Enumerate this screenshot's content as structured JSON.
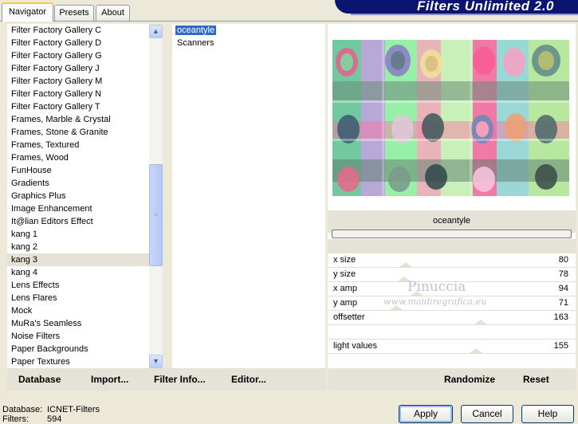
{
  "tabs": [
    {
      "label": "Navigator",
      "active": true
    },
    {
      "label": "Presets",
      "active": false
    },
    {
      "label": "About",
      "active": false
    }
  ],
  "banner": {
    "title": "Filters Unlimited 2.0"
  },
  "categories": [
    "Filter Factory Gallery C",
    "Filter Factory Gallery D",
    "Filter Factory Gallery G",
    "Filter Factory Gallery J",
    "Filter Factory Gallery M",
    "Filter Factory Gallery N",
    "Filter Factory Gallery T",
    "Frames, Marble & Crystal",
    "Frames, Stone & Granite",
    "Frames, Textured",
    "Frames, Wood",
    "FunHouse",
    "Gradients",
    "Graphics Plus",
    "Image Enhancement",
    "It@lian Editors Effect",
    "kang 1",
    "kang 2",
    "kang 3",
    "kang 4",
    "Lens Effects",
    "Lens Flares",
    "Mock",
    "MuRa's Seamless",
    "Noise Filters",
    "Paper Backgrounds",
    "Paper Textures"
  ],
  "selected_category": "kang 3",
  "effects": [
    "oceantyle",
    "Scanners"
  ],
  "selected_effect": "oceantyle",
  "preview": {
    "filter_name": "oceantyle",
    "progress": 0
  },
  "params": [
    {
      "label": "x size",
      "value": "80"
    },
    {
      "label": "y size",
      "value": "78"
    },
    {
      "label": "x amp",
      "value": "94"
    },
    {
      "label": "y amp",
      "value": "71"
    },
    {
      "label": "offsetter",
      "value": "163"
    },
    {
      "label": "",
      "value": ""
    },
    {
      "label": "light values",
      "value": "155"
    }
  ],
  "watermark": {
    "name": "Pinuccia",
    "url": "www.maidiregrafica.eu"
  },
  "left_buttons": {
    "database": "Database",
    "import": "Import...",
    "filter_info": "Filter Info...",
    "editor": "Editor..."
  },
  "right_buttons": {
    "randomize": "Randomize",
    "reset": "Reset"
  },
  "status": {
    "database_label": "Database:",
    "database_value": "ICNET-Filters",
    "filters_label": "Filters:",
    "filters_value": "594"
  },
  "dialog_buttons": {
    "apply": "Apply",
    "cancel": "Cancel",
    "help": "Help"
  },
  "colors": {
    "selection": "#316ac5",
    "banner": "#0b1570",
    "panel_bg": "#ece9d8"
  }
}
